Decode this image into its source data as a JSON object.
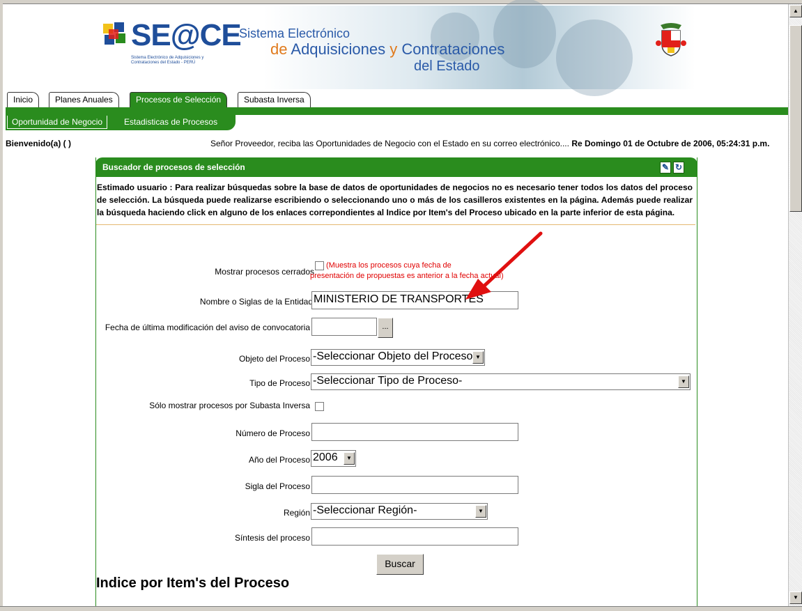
{
  "banner": {
    "logo_text": "SE@CE",
    "logo_sub": "Sistema Electrónico de Adquisiciones y Contrataciones del Estado - PERÚ",
    "line1": "Sistema Electrónico",
    "line2_de": "de",
    "line2_adq": "Adquisiciones",
    "line2_y": "y",
    "line2_con": "Contrataciones",
    "line3": "del Estado"
  },
  "tabs": [
    {
      "label": "Inicio"
    },
    {
      "label": "Planes Anuales"
    },
    {
      "label": "Procesos de Selección"
    },
    {
      "label": "Subasta Inversa"
    }
  ],
  "subtabs": [
    {
      "label": "Oportunidad de Negocio"
    },
    {
      "label": "Estadisticas de Procesos"
    }
  ],
  "welcome": "Bienvenido(a) ( )",
  "notice_text": "Señor Proveedor, reciba las Oportunidades de Negocio con el Estado en su correo electrónico....",
  "notice_date": "Re Domingo 01 de Octubre de 2006, 05:24:31 p.m.",
  "panel": {
    "title": "Buscador de procesos de selección",
    "intro": "Estimado usuario : Para realizar búsquedas sobre la base de datos de oportunidades de negocios no es necesario tener todos los datos del proceso de selección. La búsqueda puede realizarse escribiendo o seleccionando uno o más de los casilleros existentes en la página. Además puede realizar la búsqueda haciendo click en alguno de los enlaces correpondientes al Indice por Item's del Proceso ubicado en la parte inferior de esta página."
  },
  "form": {
    "mostrar_cerrados_label": "Mostrar procesos cerrados",
    "mostrar_cerrados_hint_1": "(Muestra los procesos cuya fecha de",
    "mostrar_cerrados_hint_2": "presentación de propuestas es anterior a la fecha actual)",
    "entidad_label": "Nombre o Siglas de la Entidad",
    "entidad_value": "MINISTERIO DE TRANSPORTES",
    "fecha_label": "Fecha de última modificación del aviso de convocatoria",
    "fecha_value": "",
    "fecha_button": "...",
    "objeto_label": "Objeto del Proceso",
    "objeto_value": "-Seleccionar Objeto del Proceso-",
    "tipo_label": "Tipo de Proceso",
    "tipo_value": "-Seleccionar Tipo de Proceso-",
    "subasta_label": "Sólo mostrar procesos por Subasta Inversa",
    "numero_label": "Número de Proceso",
    "numero_value": "",
    "anio_label": "Año del Proceso",
    "anio_value": "2006",
    "sigla_label": "Sigla del Proceso",
    "sigla_value": "",
    "region_label": "Región",
    "region_value": "-Seleccionar Región-",
    "sintesis_label": "Síntesis del proceso",
    "sintesis_value": "",
    "buscar_button": "Buscar"
  },
  "index_title": "Indice por Item's del Proceso",
  "colors": {
    "green": "#2a8c1e",
    "brand_blue": "#1f4e9a",
    "hint_red": "#e00000",
    "arrow_red": "#e01010"
  }
}
